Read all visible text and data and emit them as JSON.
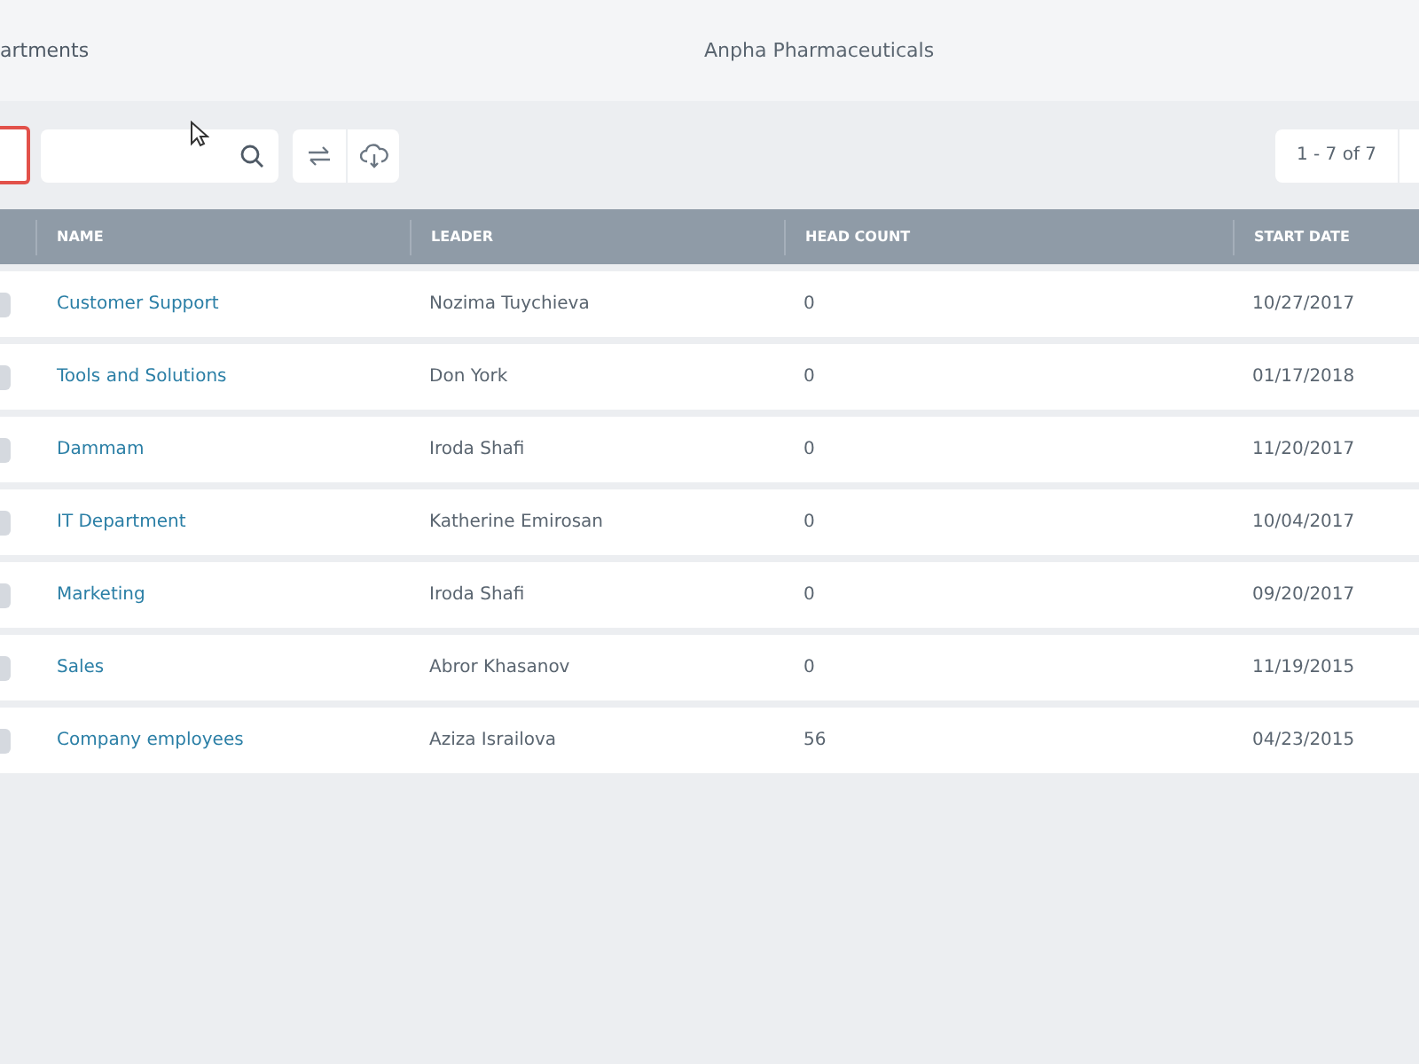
{
  "header": {
    "breadcrumb": "artments",
    "company": "Anpha Pharmaceuticals"
  },
  "toolbar": {
    "pagination": "1 - 7 of 7"
  },
  "table": {
    "columns": [
      "NAME",
      "LEADER",
      "HEAD COUNT",
      "START DATE"
    ],
    "rows": [
      {
        "checked": false,
        "name": "Customer Support",
        "leader": "Nozima Tuychieva",
        "head_count": "0",
        "start_date": "10/27/2017"
      },
      {
        "checked": false,
        "name": "Tools and Solutions",
        "leader": "Don York",
        "head_count": "0",
        "start_date": "01/17/2018"
      },
      {
        "checked": false,
        "name": "Dammam",
        "leader": "Iroda Shafi",
        "head_count": "0",
        "start_date": "11/20/2017"
      },
      {
        "checked": false,
        "name": "IT Department",
        "leader": "Katherine Emirosan",
        "head_count": "0",
        "start_date": "10/04/2017"
      },
      {
        "checked": false,
        "name": "Marketing",
        "leader": "Iroda Shafi",
        "head_count": "0",
        "start_date": "09/20/2017"
      },
      {
        "checked": false,
        "name": "Sales",
        "leader": "Abror Khasanov",
        "head_count": "0",
        "start_date": "11/19/2015"
      },
      {
        "checked": false,
        "name": "Company employees",
        "leader": "Aziza Israilova",
        "head_count": "56",
        "start_date": "04/23/2015"
      }
    ]
  }
}
